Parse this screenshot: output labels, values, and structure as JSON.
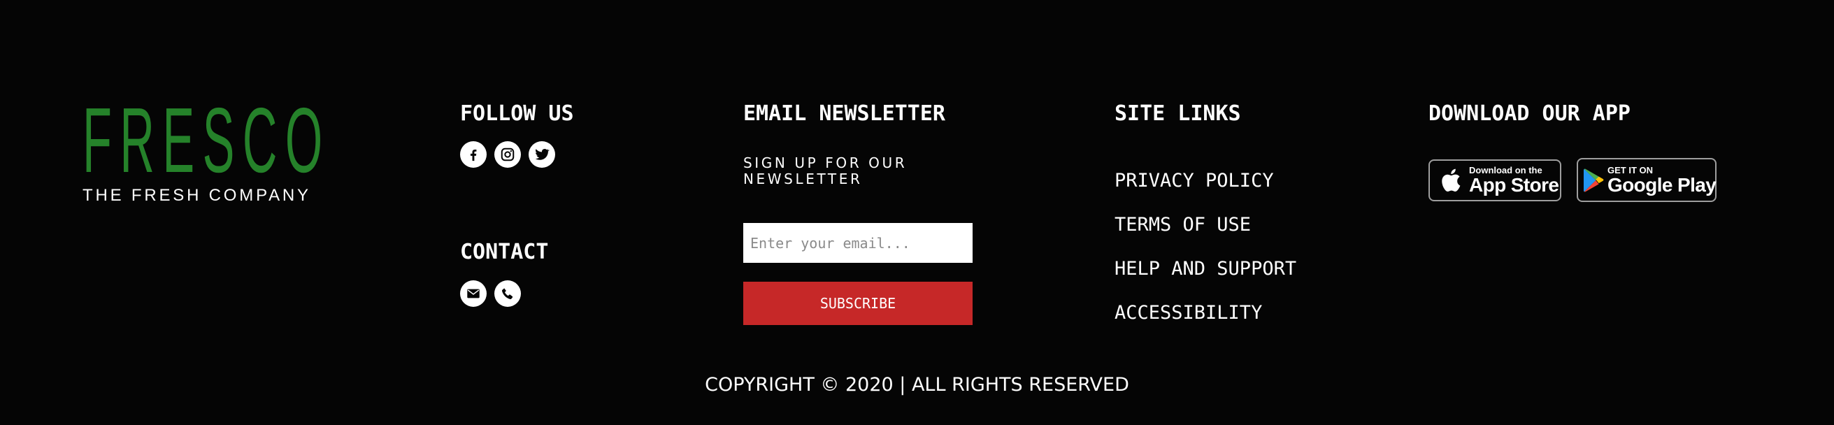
{
  "brand": {
    "name": "FRESCO",
    "tagline": "THE FRESH COMPANY",
    "color": "#25822a"
  },
  "follow": {
    "heading": "FOLLOW US",
    "icons": [
      "facebook-icon",
      "instagram-icon",
      "twitter-icon"
    ]
  },
  "contact": {
    "heading": "CONTACT",
    "icons": [
      "email-icon",
      "phone-icon"
    ]
  },
  "newsletter": {
    "heading": "EMAIL NEWSLETTER",
    "signup_label": "SIGN UP FOR OUR NEWSLETTER",
    "email_placeholder": "Enter your email...",
    "email_value": "",
    "subscribe_label": "SUBSCRIBE",
    "button_color": "#c62828"
  },
  "site_links": {
    "heading": "SITE LINKS",
    "items": [
      "PRIVACY POLICY",
      "TERMS OF USE",
      "HELP AND SUPPORT",
      "ACCESSIBILITY"
    ]
  },
  "app": {
    "heading": "DOWNLOAD OUR APP",
    "app_store": {
      "small": "Download on the",
      "big": "App Store",
      "icon": "apple-icon"
    },
    "google_play": {
      "small": "GET IT ON",
      "big": "Google Play",
      "icon": "google-play-icon"
    }
  },
  "footer": {
    "copyright": "COPYRIGHT © 2020 | ALL RIGHTS RESERVED"
  }
}
